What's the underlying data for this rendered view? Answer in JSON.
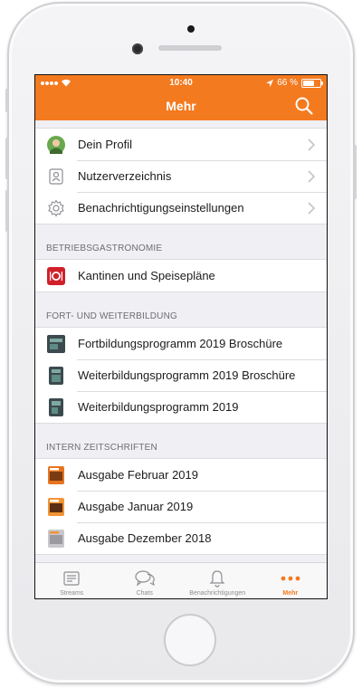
{
  "statusbar": {
    "time": "10:40",
    "battery": "66 %"
  },
  "navbar": {
    "title": "Mehr"
  },
  "profile_group": [
    {
      "label": "Dein Profil"
    },
    {
      "label": "Nutzerverzeichnis"
    },
    {
      "label": "Benachrichtigungseinstellungen"
    }
  ],
  "sections": [
    {
      "header": "BETRIEBSGASTRONOMIE",
      "items": [
        {
          "label": "Kantinen und Speisepläne"
        }
      ]
    },
    {
      "header": "FORT- UND WEITERBILDUNG",
      "items": [
        {
          "label": "Fortbildungsprogramm 2019 Broschüre"
        },
        {
          "label": "Weiterbildungsprogramm 2019 Broschüre"
        },
        {
          "label": "Weiterbildungsprogramm 2019"
        }
      ]
    },
    {
      "header": "INTERN ZEITSCHRIFTEN",
      "items": [
        {
          "label": "Ausgabe Februar 2019"
        },
        {
          "label": "Ausgabe Januar 2019"
        },
        {
          "label": "Ausgabe Dezember 2018"
        }
      ]
    }
  ],
  "tabbar": [
    {
      "label": "Streams"
    },
    {
      "label": "Chats"
    },
    {
      "label": "Benachrichtigungen"
    },
    {
      "label": "Mehr"
    }
  ],
  "colors": {
    "accent": "#f47a1f",
    "background": "#efeff4"
  }
}
